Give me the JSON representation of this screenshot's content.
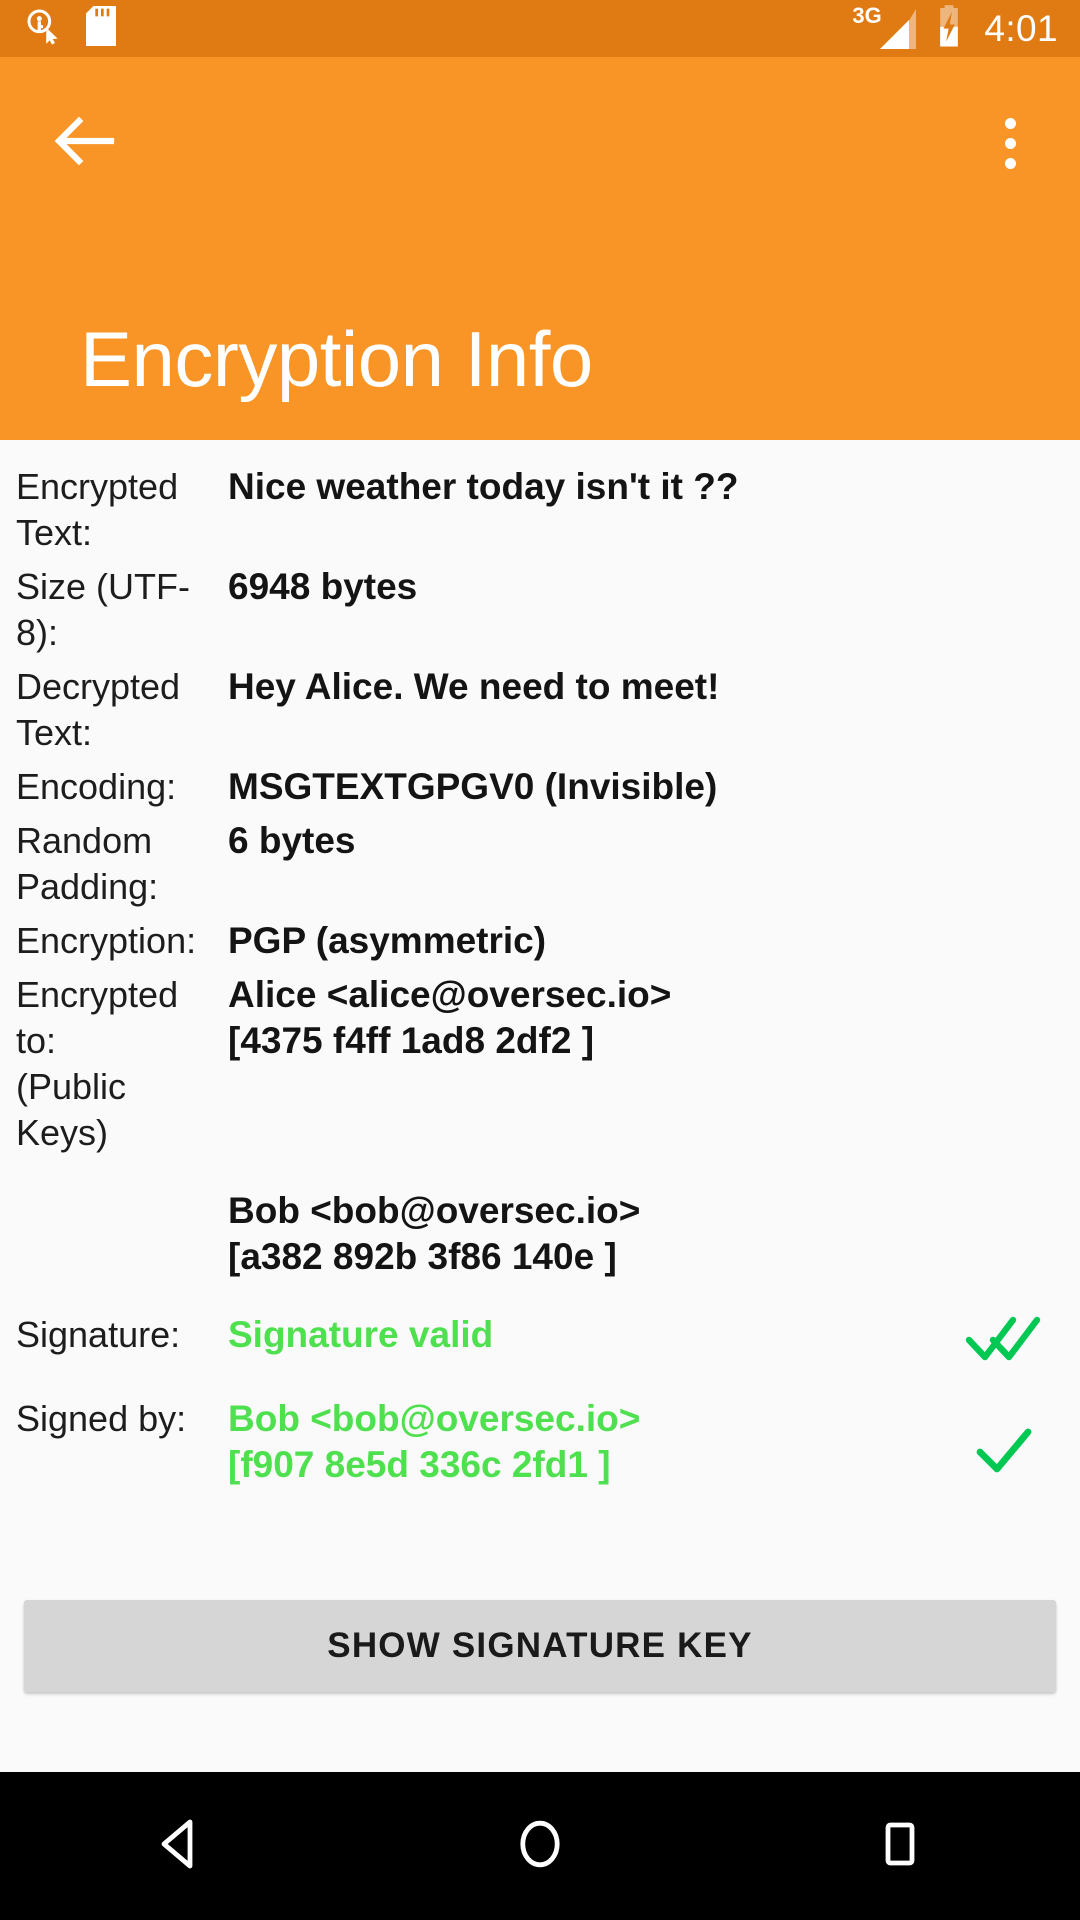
{
  "statusbar": {
    "icons": [
      "oversec-key-icon",
      "sd-card-icon"
    ],
    "network_label": "3G",
    "battery": "battery-charging-icon",
    "time": "4:01",
    "bg_color": "#E07A12"
  },
  "appbar": {
    "back_label": "back-arrow",
    "overflow_label": "more-options",
    "title": "Encryption Info",
    "bg_color": "#F99527"
  },
  "details": {
    "rows": [
      {
        "label": "Encrypted\nText:",
        "value": "Nice weather today isn't it ??",
        "green": false,
        "check": "none"
      },
      {
        "label": "Size (UTF-8):",
        "value": "6948 bytes",
        "green": false,
        "check": "none"
      },
      {
        "label": "Decrypted\nText:",
        "value": "Hey Alice. We need to meet!",
        "green": false,
        "check": "none"
      },
      {
        "label": "Encoding:",
        "value": "MSGTEXTGPGV0 (Invisible)",
        "green": false,
        "check": "none"
      },
      {
        "label": "Random\nPadding:",
        "value": "6 bytes",
        "green": false,
        "check": "none"
      },
      {
        "label": "Encryption:",
        "value": "PGP (asymmetric)",
        "green": false,
        "check": "none"
      },
      {
        "label": "Encrypted to:\n(Public Keys)",
        "value": "Alice <alice@oversec.io>\n[4375 f4ff 1ad8 2df2 ]",
        "green": false,
        "check": "none"
      },
      {
        "label": "",
        "value": "Bob <bob@oversec.io>\n[a382 892b 3f86 140e ]",
        "green": false,
        "check": "none"
      },
      {
        "label": "Signature:",
        "value": "Signature valid",
        "green": true,
        "check": "double"
      },
      {
        "label": "Signed by:",
        "value": "Bob <bob@oversec.io>\n[f907 8e5d 336c 2fd1 ]",
        "green": true,
        "check": "single"
      }
    ],
    "green_color": "#4FE04F",
    "check_color": "#00C853"
  },
  "action": {
    "show_signature_key_label": "SHOW SIGNATURE KEY"
  },
  "navbar": {
    "back": "nav-back-icon",
    "home": "nav-home-icon",
    "recents": "nav-recents-icon"
  }
}
